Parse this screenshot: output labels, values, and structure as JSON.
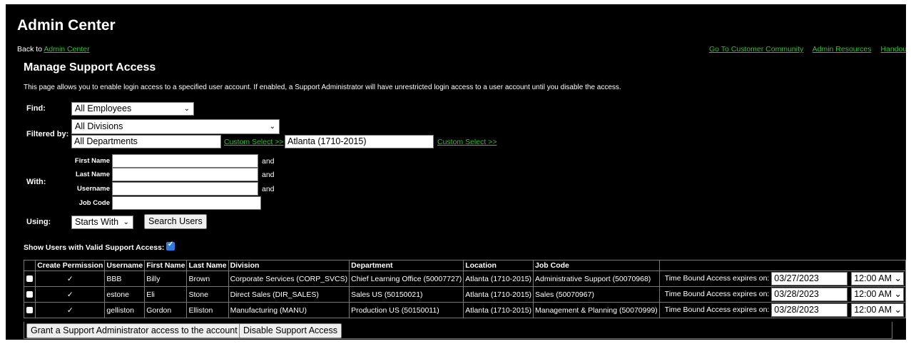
{
  "app_title": "Admin Center",
  "back": {
    "prefix": "Back to",
    "link": "Admin Center"
  },
  "top_links": [
    "Go To Customer Community",
    "Admin Resources",
    "Handout I"
  ],
  "section_title": "Manage Support Access",
  "description": "This page allows you to enable login access to a specified user account. If enabled, a Support Administrator will have unrestricted login access to a user account until you disable the access.",
  "find": {
    "label": "Find:",
    "value": "All Employees"
  },
  "filter": {
    "label": "Filtered by:",
    "division": "All Divisions",
    "department": "All Departments",
    "custom_select_1": "Custom Select >>",
    "location": "Atlanta (1710-2015)",
    "custom_select_2": "Custom Select >>"
  },
  "with": {
    "label": "With:",
    "first_name": "First Name",
    "last_name": "Last Name",
    "username": "Username",
    "job_code": "Job Code",
    "and": "and"
  },
  "using": {
    "label": "Using:",
    "value": "Starts With",
    "search_button": "Search Users"
  },
  "show_valid": {
    "label": "Show Users with Valid Support Access:",
    "checked": true
  },
  "table": {
    "headers": [
      "",
      "Create Permission",
      "Username",
      "First Name",
      "Last Name",
      "Division",
      "Department",
      "Location",
      "Job Code",
      ""
    ],
    "rows": [
      {
        "check": "✓",
        "username": "BBB",
        "first": "Billy",
        "last": "Brown",
        "division": "Corporate Services (CORP_SVCS)",
        "department": "Chief Learning Office (50007727)",
        "location": "Atlanta (1710-2015)",
        "job_code": "Administrative Support (50070968)",
        "expires_label": "Time Bound Access expires on:",
        "date": "03/27/2023",
        "time": "12:00 AM"
      },
      {
        "check": "✓",
        "username": "estone",
        "first": "Eli",
        "last": "Stone",
        "division": "Direct Sales (DIR_SALES)",
        "department": "Sales US (50150021)",
        "location": "Atlanta (1710-2015)",
        "job_code": "Sales (50070967)",
        "expires_label": "Time Bound Access expires on:",
        "date": "03/28/2023",
        "time": "12:00 AM"
      },
      {
        "check": "✓",
        "username": "gelliston",
        "first": "Gordon",
        "last": "Elliston",
        "division": "Manufacturing (MANU)",
        "department": "Production US (50150011)",
        "location": "Atlanta (1710-2015)",
        "job_code": "Management & Planning (50070999)",
        "expires_label": "Time Bound Access expires on:",
        "date": "03/28/2023",
        "time": "12:00 AM"
      }
    ]
  },
  "buttons": {
    "grant": "Grant a Support Administrator access to the account",
    "disable": "Disable Support Access"
  },
  "colors": {
    "background": "#000000",
    "link": "#31c02a",
    "checkbox": "#2f7be0"
  }
}
